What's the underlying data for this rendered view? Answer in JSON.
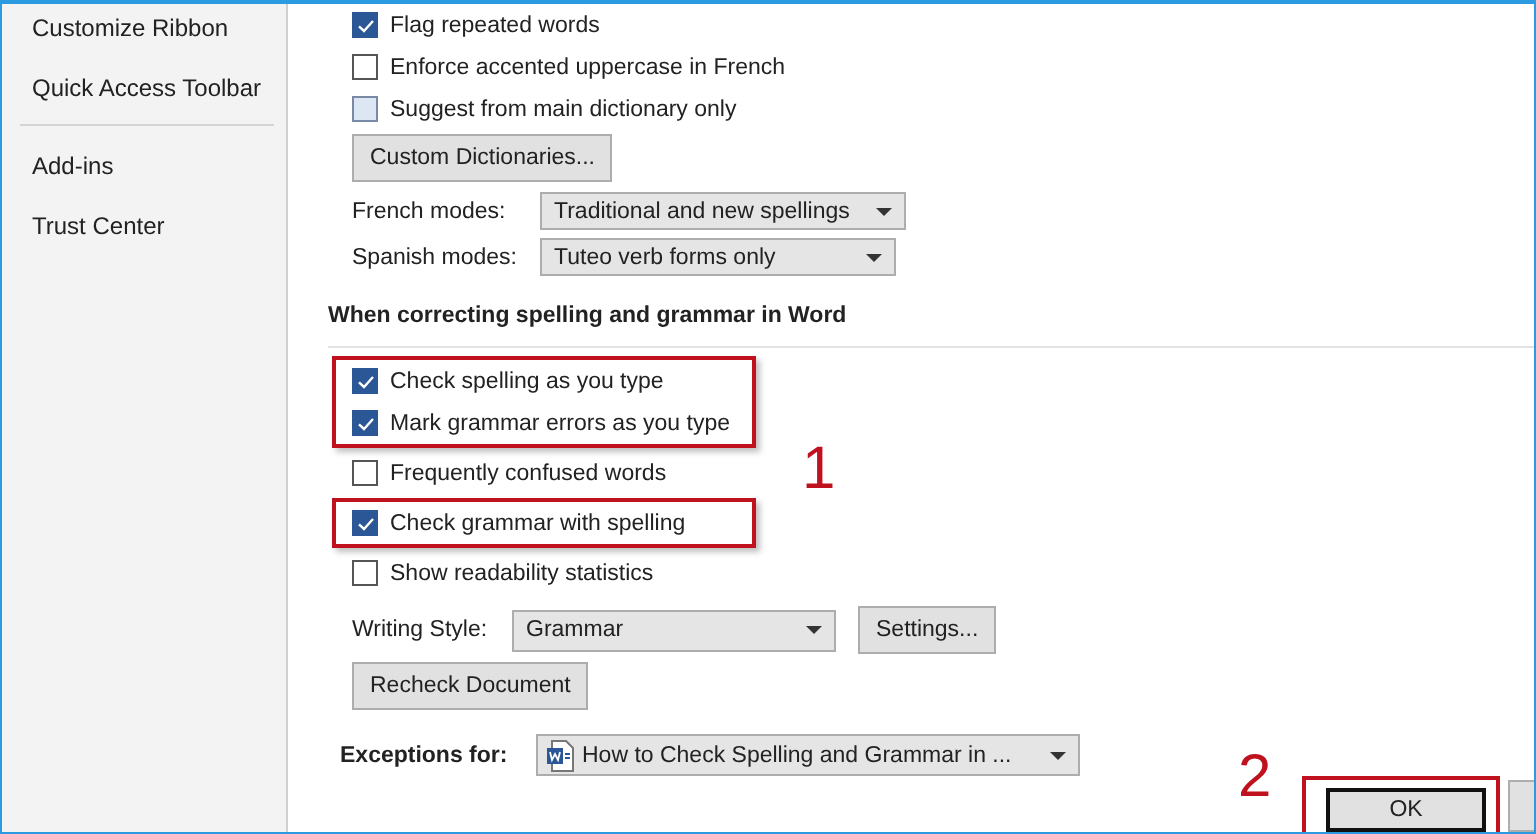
{
  "sidebar": {
    "groups": [
      [
        "Customize Ribbon",
        "Quick Access Toolbar"
      ],
      [
        "Add-ins",
        "Trust Center"
      ]
    ]
  },
  "top_options": [
    {
      "label": "Flag repeated words",
      "checked": true
    },
    {
      "label": "Enforce accented uppercase in French",
      "checked": false
    },
    {
      "label": "Suggest from main dictionary only",
      "checked": false,
      "disabled": true
    }
  ],
  "custom_dictionaries_button": "Custom Dictionaries...",
  "modes": [
    {
      "label": "French modes:",
      "value": "Traditional and new spellings"
    },
    {
      "label": "Spanish modes:",
      "value": "Tuteo verb forms only"
    }
  ],
  "section_heading": "When correcting spelling and grammar in Word",
  "grammar_options": [
    {
      "label": "Check spelling as you type",
      "checked": true,
      "highlighted": true
    },
    {
      "label": "Mark grammar errors as you type",
      "checked": true,
      "highlighted": true
    },
    {
      "label": "Frequently confused words",
      "checked": false,
      "highlighted": false
    },
    {
      "label": "Check grammar with spelling",
      "checked": true,
      "highlighted": true
    },
    {
      "label": "Show readability statistics",
      "checked": false,
      "highlighted": false
    }
  ],
  "writing_style": {
    "label": "Writing Style:",
    "value": "Grammar",
    "button": "Settings..."
  },
  "recheck_button": "Recheck Document",
  "exceptions": {
    "label": "Exceptions for:",
    "value": "How to Check Spelling and Grammar in ..."
  },
  "callouts": [
    "1",
    "2"
  ],
  "footer": {
    "ok_button": "OK",
    "ok_highlighted": true
  }
}
